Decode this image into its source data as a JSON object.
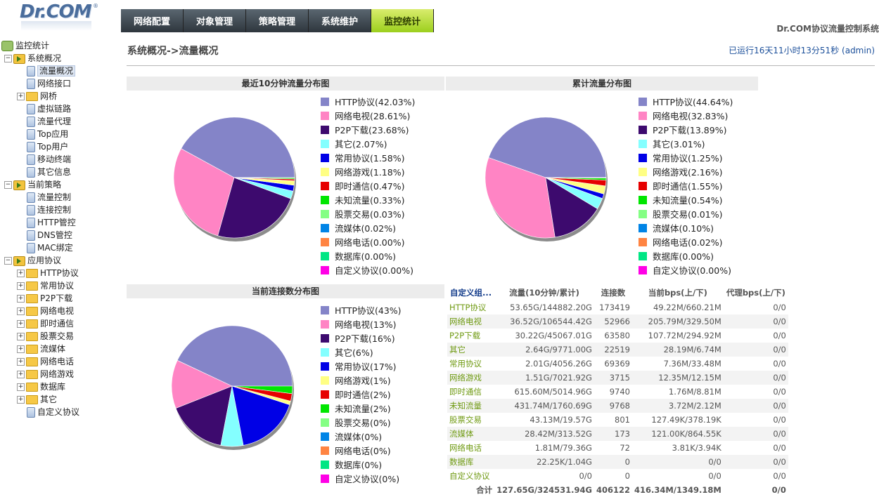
{
  "logo": {
    "text": "Dr.COM",
    "mark": "®"
  },
  "nav": {
    "tabs": [
      "网络配置",
      "对象管理",
      "策略管理",
      "系统维护",
      "监控统计"
    ],
    "active": 4
  },
  "product_name": "Dr.COM协议流量控制系统",
  "breadcrumb": "系统概况->流量概况",
  "uptime": {
    "prefix": "已运行",
    "value": "16天11小时13分51秒",
    "user": "(admin)"
  },
  "tree": {
    "root": "监控统计",
    "groups": [
      {
        "label": "系统概况",
        "items": [
          {
            "label": "流量概况",
            "type": "doc",
            "selected": true
          },
          {
            "label": "网络接口",
            "type": "doc"
          },
          {
            "label": "网桥",
            "type": "folder"
          },
          {
            "label": "虚拟链路",
            "type": "doc"
          },
          {
            "label": "流量代理",
            "type": "doc"
          },
          {
            "label": "Top应用",
            "type": "doc"
          },
          {
            "label": "Top用户",
            "type": "doc"
          },
          {
            "label": "移动终端",
            "type": "doc"
          },
          {
            "label": "其它信息",
            "type": "doc"
          }
        ]
      },
      {
        "label": "当前策略",
        "items": [
          {
            "label": "流量控制",
            "type": "doc"
          },
          {
            "label": "连接控制",
            "type": "doc"
          },
          {
            "label": "HTTP管控",
            "type": "doc"
          },
          {
            "label": "DNS管控",
            "type": "doc"
          },
          {
            "label": "MAC绑定",
            "type": "doc"
          }
        ]
      },
      {
        "label": "应用协议",
        "items": [
          {
            "label": "HTTP协议",
            "type": "folder"
          },
          {
            "label": "常用协议",
            "type": "folder"
          },
          {
            "label": "P2P下载",
            "type": "folder"
          },
          {
            "label": "网络电视",
            "type": "folder"
          },
          {
            "label": "即时通信",
            "type": "folder"
          },
          {
            "label": "股票交易",
            "type": "folder"
          },
          {
            "label": "流媒体",
            "type": "folder"
          },
          {
            "label": "网络电话",
            "type": "folder"
          },
          {
            "label": "网络游戏",
            "type": "folder"
          },
          {
            "label": "数据库",
            "type": "folder"
          },
          {
            "label": "其它",
            "type": "folder"
          },
          {
            "label": "自定义协议",
            "type": "doc"
          }
        ]
      }
    ]
  },
  "colors": [
    "#8484c8",
    "#ff84c4",
    "#3d0a6e",
    "#84ffff",
    "#0000e6",
    "#ffff84",
    "#e60000",
    "#00e600",
    "#84ff84",
    "#0084e6",
    "#ff8442",
    "#00e684",
    "#ff00e6"
  ],
  "chart_data": [
    {
      "type": "pie",
      "title": "最近10分钟流量分布图",
      "labels": [
        "HTTP协议",
        "网络电视",
        "P2P下载",
        "其它",
        "常用协议",
        "网络游戏",
        "即时通信",
        "未知流量",
        "股票交易",
        "流媒体",
        "网络电话",
        "数据库",
        "自定义协议"
      ],
      "values": [
        42.03,
        28.61,
        23.68,
        2.07,
        1.58,
        1.18,
        0.47,
        0.33,
        0.03,
        0.02,
        0.0,
        0.0,
        0.0
      ],
      "legend_text": [
        "HTTP协议(42.03%)",
        "网络电视(28.61%)",
        "P2P下载(23.68%)",
        "其它(2.07%)",
        "常用协议(1.58%)",
        "网络游戏(1.18%)",
        "即时通信(0.47%)",
        "未知流量(0.33%)",
        "股票交易(0.03%)",
        "流媒体(0.02%)",
        "网络电话(0.00%)",
        "数据库(0.00%)",
        "自定义协议(0.00%)"
      ]
    },
    {
      "type": "pie",
      "title": "累计流量分布图",
      "labels": [
        "HTTP协议",
        "网络电视",
        "P2P下载",
        "其它",
        "常用协议",
        "网络游戏",
        "即时通信",
        "未知流量",
        "股票交易",
        "流媒体",
        "网络电话",
        "数据库",
        "自定义协议"
      ],
      "values": [
        44.64,
        32.83,
        13.89,
        3.01,
        1.25,
        2.16,
        1.55,
        0.54,
        0.01,
        0.1,
        0.02,
        0.0,
        0.0
      ],
      "legend_text": [
        "HTTP协议(44.64%)",
        "网络电视(32.83%)",
        "P2P下载(13.89%)",
        "其它(3.01%)",
        "常用协议(1.25%)",
        "网络游戏(2.16%)",
        "即时通信(1.55%)",
        "未知流量(0.54%)",
        "股票交易(0.01%)",
        "流媒体(0.10%)",
        "网络电话(0.02%)",
        "数据库(0.00%)",
        "自定义协议(0.00%)"
      ]
    },
    {
      "type": "pie",
      "title": "当前连接数分布图",
      "labels": [
        "HTTP协议",
        "网络电视",
        "P2P下载",
        "其它",
        "常用协议",
        "网络游戏",
        "即时通信",
        "未知流量",
        "股票交易",
        "流媒体",
        "网络电话",
        "数据库",
        "自定义协议"
      ],
      "values": [
        43,
        13,
        16,
        6,
        17,
        1,
        2,
        2,
        0,
        0,
        0,
        0,
        0
      ],
      "legend_text": [
        "HTTP协议(43%)",
        "网络电视(13%)",
        "P2P下载(16%)",
        "其它(6%)",
        "常用协议(17%)",
        "网络游戏(1%)",
        "即时通信(2%)",
        "未知流量(2%)",
        "股票交易(0%)",
        "流媒体(0%)",
        "网络电话(0%)",
        "数据库(0%)",
        "自定义协议(0%)"
      ]
    }
  ],
  "table": {
    "headers": [
      "自定义组...",
      "流量(10分钟/累计)",
      "连接数",
      "当前bps(上/下)",
      "代理bps(上/下)"
    ],
    "rows": [
      [
        "HTTP协议",
        "53.65G/144882.20G",
        "173419",
        "49.22M/660.21M",
        "0/0"
      ],
      [
        "网络电视",
        "36.52G/106544.42G",
        "52966",
        "205.79M/329.50M",
        "0/0"
      ],
      [
        "P2P下载",
        "30.22G/45067.01G",
        "63580",
        "107.72M/294.92M",
        "0/0"
      ],
      [
        "其它",
        "2.64G/9771.00G",
        "22519",
        "28.19M/6.74M",
        "0/0"
      ],
      [
        "常用协议",
        "2.01G/4056.26G",
        "69369",
        "7.36M/33.48M",
        "0/0"
      ],
      [
        "网络游戏",
        "1.51G/7021.92G",
        "3715",
        "12.35M/12.15M",
        "0/0"
      ],
      [
        "即时通信",
        "615.60M/5014.96G",
        "9740",
        "1.76M/8.81M",
        "0/0"
      ],
      [
        "未知流量",
        "431.74M/1760.69G",
        "9768",
        "3.72M/2.12M",
        "0/0"
      ],
      [
        "股票交易",
        "43.13M/19.57G",
        "801",
        "127.49K/378.19K",
        "0/0"
      ],
      [
        "流媒体",
        "28.42M/313.52G",
        "173",
        "121.00K/864.55K",
        "0/0"
      ],
      [
        "网络电话",
        "1.81M/79.36G",
        "72",
        "3.81K/3.94K",
        "0/0"
      ],
      [
        "数据库",
        "22.25K/1.04G",
        "0",
        "0/0",
        "0/0"
      ],
      [
        "自定义协议",
        "0/0",
        "0",
        "0/0",
        "0/0"
      ],
      [
        "合计",
        "127.65G/324531.94G",
        "406122",
        "416.34M/1349.18M",
        "0/0"
      ]
    ]
  }
}
